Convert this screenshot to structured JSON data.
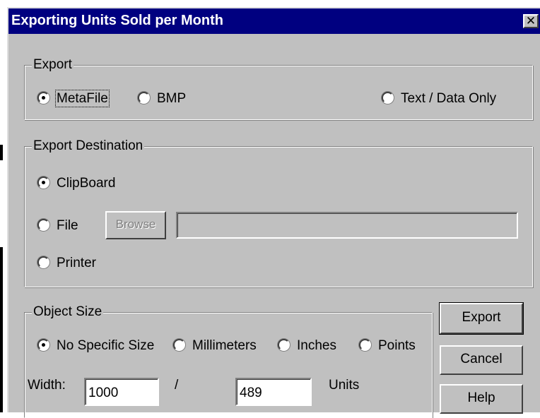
{
  "window": {
    "title": "Exporting Units Sold per Month",
    "close_glyph": "✕",
    "close_icon": "close-icon"
  },
  "export_group": {
    "legend": "Export",
    "options": [
      {
        "label": "MetaFile",
        "mnemonic": "M",
        "checked": true
      },
      {
        "label": "BMP",
        "mnemonic": "B",
        "checked": false
      },
      {
        "label": "Text / Data Only",
        "mnemonic": "T",
        "checked": false
      }
    ]
  },
  "destination_group": {
    "legend": "Export Destination",
    "options": [
      {
        "label": "ClipBoard",
        "mnemonic": "C",
        "checked": true
      },
      {
        "label": "File",
        "mnemonic": "F",
        "checked": false
      },
      {
        "label": "Printer",
        "mnemonic": "P",
        "checked": false
      }
    ],
    "browse_label": "Browse",
    "file_path": ""
  },
  "size_group": {
    "legend": "Object Size",
    "options": [
      {
        "label": "No Specific Size",
        "checked": true
      },
      {
        "label": "Millimeters",
        "checked": false
      },
      {
        "label": "Inches",
        "checked": false
      },
      {
        "label": "Points",
        "checked": false
      }
    ],
    "width_label": "Width:",
    "width_value": "1000",
    "separator": "/",
    "height_value": "489",
    "units_label": "Units"
  },
  "buttons": {
    "export": "Export",
    "cancel": "Cancel",
    "help": "Help"
  }
}
